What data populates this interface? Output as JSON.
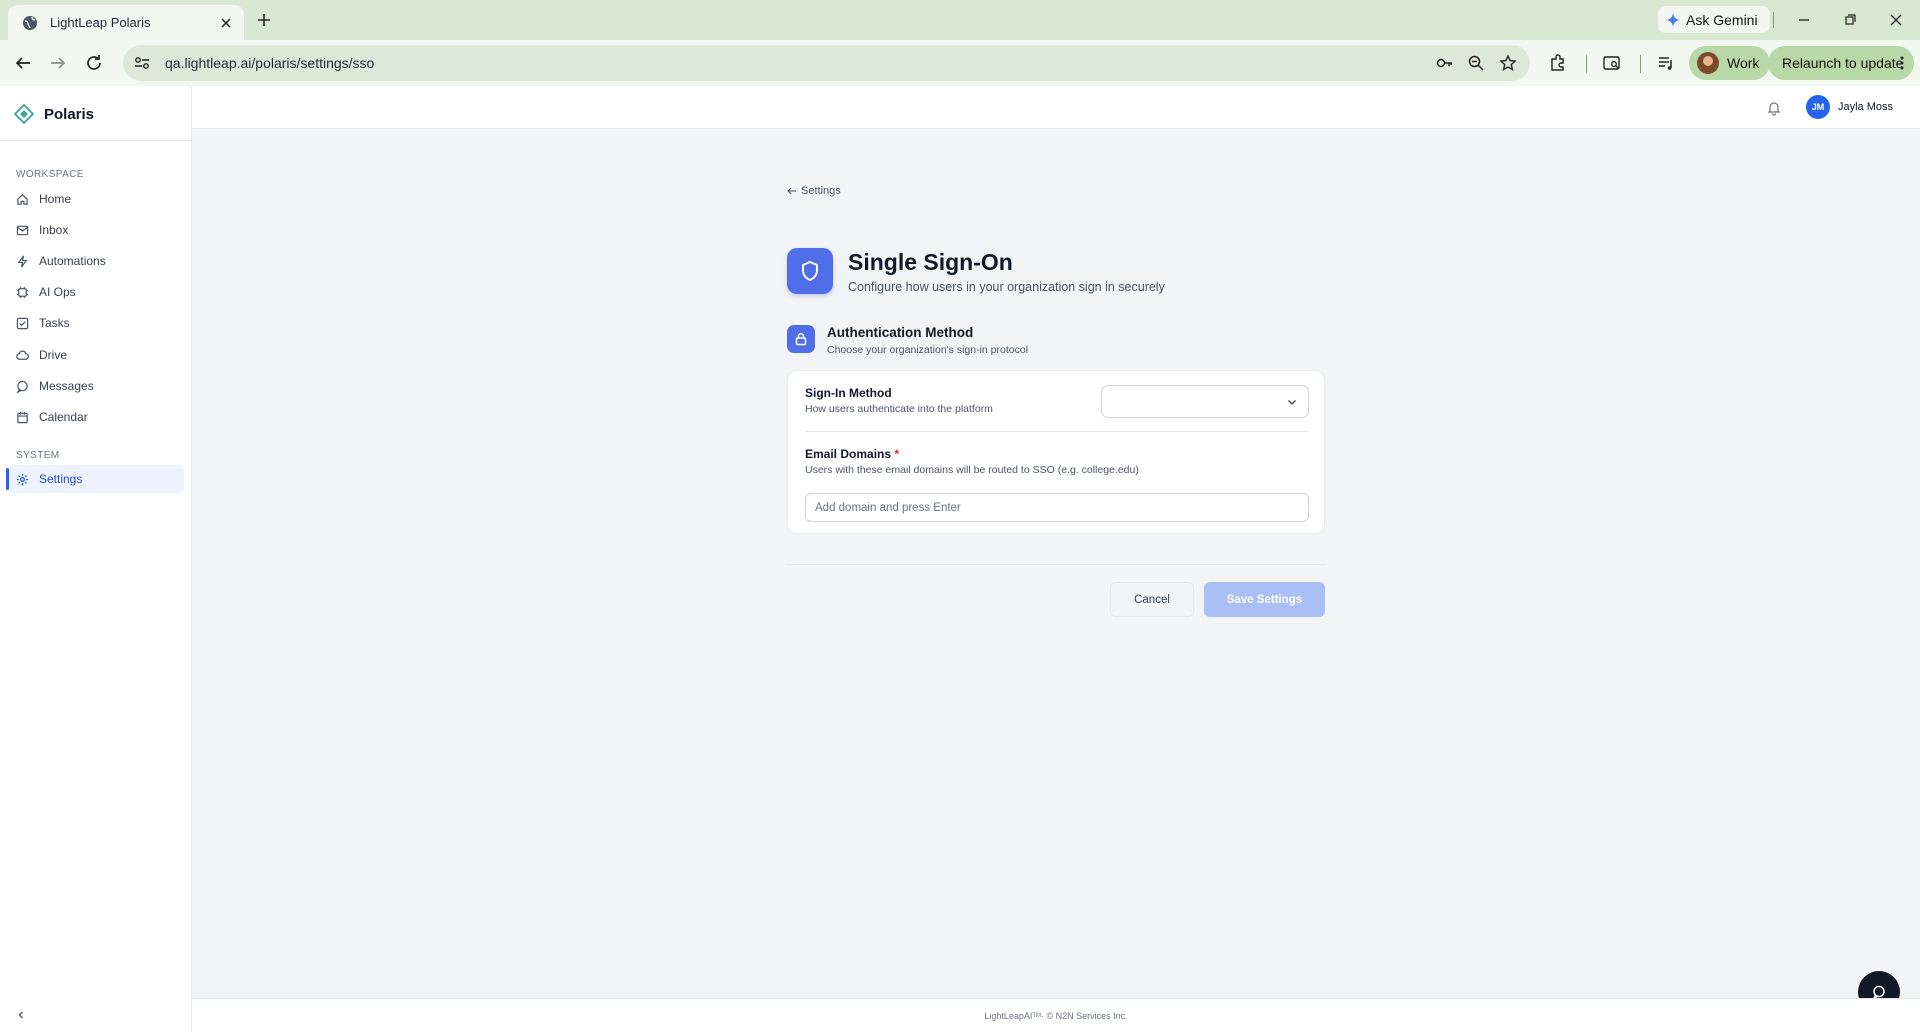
{
  "browser": {
    "tab_title": "LightLeap Polaris",
    "ask_gemini": "Ask Gemini",
    "url": "qa.lightleap.ai/polaris/settings/sso",
    "profile_label": "Work",
    "relaunch_label": "Relaunch to update"
  },
  "sidebar": {
    "brand": "Polaris",
    "workspace_label": "WORKSPACE",
    "items": [
      {
        "label": "Home",
        "icon": "home-icon"
      },
      {
        "label": "Inbox",
        "icon": "inbox-icon"
      },
      {
        "label": "Automations",
        "icon": "lightning-icon"
      },
      {
        "label": "AI Ops",
        "icon": "chip-icon"
      },
      {
        "label": "Tasks",
        "icon": "checkbox-icon"
      },
      {
        "label": "Drive",
        "icon": "cloud-icon"
      },
      {
        "label": "Messages",
        "icon": "chat-icon"
      },
      {
        "label": "Calendar",
        "icon": "calendar-icon"
      }
    ],
    "system_label": "SYSTEM",
    "settings_label": "Settings"
  },
  "topbar": {
    "user_initials": "JM",
    "user_name": "Jayla Moss"
  },
  "page": {
    "back_label": "Settings",
    "title": "Single Sign-On",
    "subtitle": "Configure how users in your organization sign in securely",
    "section_title": "Authentication Method",
    "section_subtitle": "Choose your organization's sign-in protocol",
    "sign_in_label": "Sign-In Method",
    "sign_in_help": "How users authenticate into the platform",
    "sign_in_value": "",
    "domains_label": "Email Domains",
    "domains_required": "*",
    "domains_help": "Users with these email domains will be routed to SSO (e.g. college.edu)",
    "domains_placeholder": "Add domain and press Enter",
    "cancel_label": "Cancel",
    "save_label": "Save Settings"
  },
  "footer": {
    "brand": "LightLeapAI",
    "tm": "TM",
    "copyright": " · © N2N Services Inc."
  },
  "colors": {
    "accent": "#4f6ee8",
    "active_nav_bg": "#eef2ff",
    "save_disabled": "#a9bff5",
    "chrome_green": "#d8e8d3"
  }
}
